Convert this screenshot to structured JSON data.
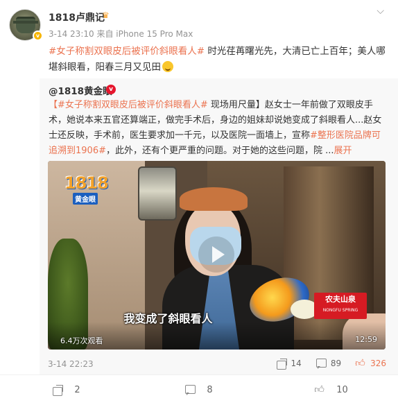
{
  "post": {
    "username": "1818卢鼎记",
    "meta": "3-14 23:10  来自 iPhone 15 Pro Max",
    "hashtag": "#女子称割双眼皮后被评价斜眼看人#",
    "text": " 时光荏苒曙光先，大清已亡上百年；美人哪堪斜眼看，阳春三月又见田",
    "emoji": "grinning-face"
  },
  "repost": {
    "author": "@1818黄金眼",
    "hashtag": "【#女子称割双眼皮后被评价斜眼看人#",
    "text1": " 现场用尺量】赵女士一年前做了双眼皮手术，她说本来五官还算端正，做完手术后，身边的姐妹却说她变成了斜眼看人...赵女士还反映，手术前，医生要求加一千元，以及医院一面墙上，宣称",
    "hashtag2": "#整形医院品牌可追溯到1906#",
    "text2": "，此外，还有个更严重的问题。对于她的这些问题，院 ...",
    "expand": "展开",
    "video": {
      "logo_big": "1818",
      "logo_small": "黄金眼",
      "subtitle": "我变成了斜眼看人",
      "brand_cn": "农夫山泉",
      "brand_en": "NONGFU SPRING",
      "views": "6.4万次观看",
      "duration": "12:59"
    },
    "time": "3-14 22:23",
    "shares": "14",
    "comments": "89",
    "likes": "326"
  },
  "bottom": {
    "shares": "2",
    "comments": "8",
    "likes": "10"
  }
}
